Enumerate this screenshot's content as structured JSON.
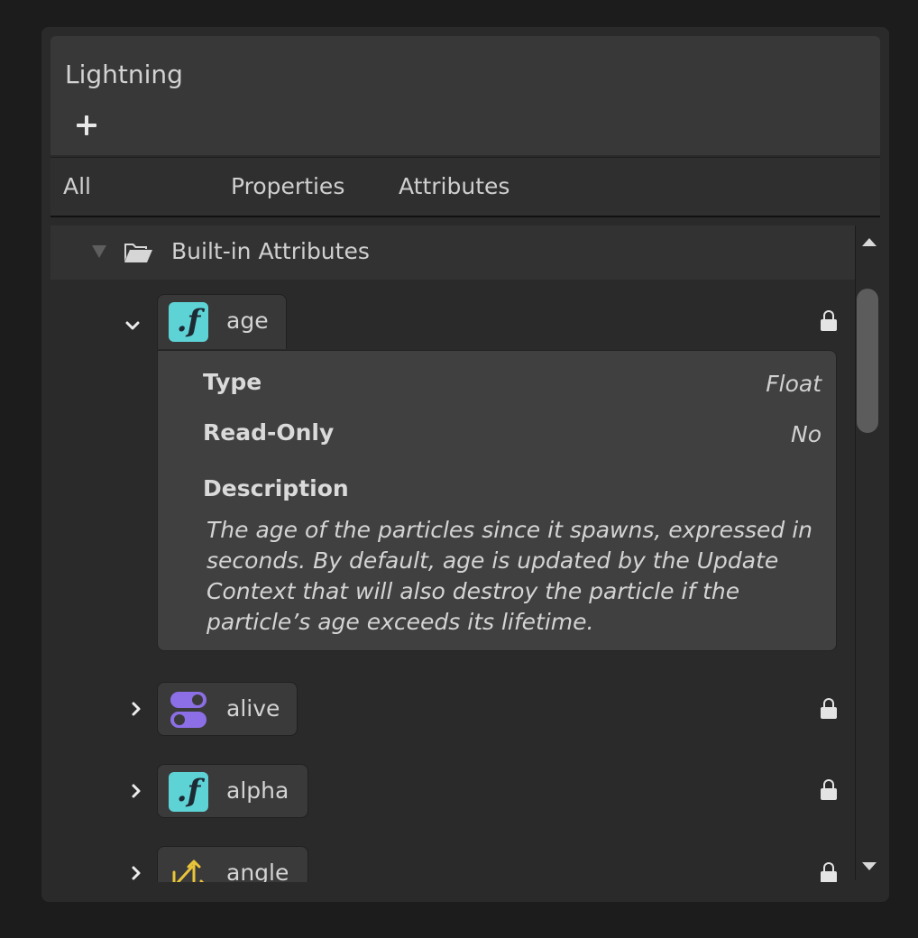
{
  "panel": {
    "title": "Lightning",
    "add_icon": "plus-icon"
  },
  "tabs": [
    {
      "label": "All"
    },
    {
      "label": "Properties"
    },
    {
      "label": "Attributes"
    }
  ],
  "section": {
    "label": "Built-in Attributes",
    "expanded": true,
    "icon": "folder-open-icon"
  },
  "attributes": [
    {
      "name": "age",
      "type_icon": "float-icon",
      "icon_text": ".f",
      "icon_color": "#5ed3d6",
      "expanded": true,
      "locked": true,
      "details": {
        "type_label": "Type",
        "type_value": "Float",
        "readonly_label": "Read-Only",
        "readonly_value": "No",
        "description_label": "Description",
        "description": "The age of the particles since it spawns, expressed in seconds. By default, age is updated by the Update Context that will also destroy the particle if the particle’s age exceeds its lifetime."
      }
    },
    {
      "name": "alive",
      "type_icon": "boolean-toggle-icon",
      "icon_color": "#8c6fe6",
      "expanded": false,
      "locked": true
    },
    {
      "name": "alpha",
      "type_icon": "float-icon",
      "icon_text": ".f",
      "icon_color": "#5ed3d6",
      "expanded": false,
      "locked": true
    },
    {
      "name": "angle",
      "type_icon": "vector-icon",
      "icon_color": "#e8c43a",
      "expanded": false,
      "locked": true
    }
  ],
  "colors": {
    "background": "#1c1c1c",
    "panel": "#2a2a2a",
    "header": "#383838",
    "float_icon": "#5ed3d6",
    "bool_icon": "#8c6fe6",
    "vector_icon": "#e8c43a"
  }
}
